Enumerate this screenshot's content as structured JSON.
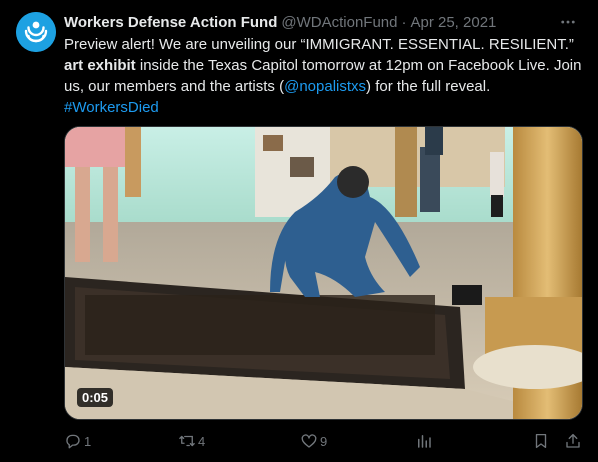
{
  "tweet": {
    "author_name": "Workers Defense Action Fund",
    "handle": "@WDActionFund",
    "separator": "·",
    "date": "Apr 25, 2021",
    "text": {
      "part1": "Preview alert! We are unveiling our “IMMIGRANT. ESSENTIAL. RESILIENT.” ",
      "bold": "art exhibit",
      "part2": " inside the Texas Capitol tomorrow at 12pm on Facebook Live. Join us, our members and the artists (",
      "mention": "@nopalistxs",
      "part3": ") for the full reveal.",
      "hashtag": "#WorkersDied"
    },
    "media": {
      "duration": "0:05"
    },
    "actions": {
      "replies": "1",
      "retweets": "4",
      "likes": "9"
    }
  },
  "icons": {
    "avatar": "workers-defense-logo",
    "more": "more-dots-icon",
    "reply": "reply-icon",
    "retweet": "retweet-icon",
    "like": "heart-icon",
    "views": "analytics-icon",
    "bookmark": "bookmark-icon",
    "share": "share-icon"
  },
  "colors": {
    "background": "#000000",
    "text": "#e7e9ea",
    "muted": "#71767b",
    "link": "#1d9bf0",
    "brand": "#1da1e2"
  }
}
